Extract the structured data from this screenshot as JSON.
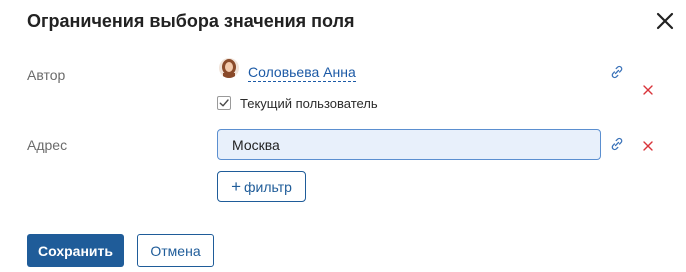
{
  "dialog": {
    "title": "Ограничения выбора значения поля",
    "close_icon": "close-icon"
  },
  "fields": {
    "author": {
      "label": "Автор",
      "user_name": "Соловьева Анна",
      "current_user_label": "Текущий пользователь",
      "current_user_checked": true
    },
    "address": {
      "label": "Адрес",
      "value": "Москва"
    }
  },
  "filter_button": {
    "plus": "+",
    "label": "фильтр"
  },
  "footer": {
    "save_label": "Сохранить",
    "cancel_label": "Отмена"
  },
  "colors": {
    "primary": "#1f5c99",
    "link": "#1c5aa6",
    "delete": "#d9343a",
    "input_bg": "#e8f0fb"
  }
}
